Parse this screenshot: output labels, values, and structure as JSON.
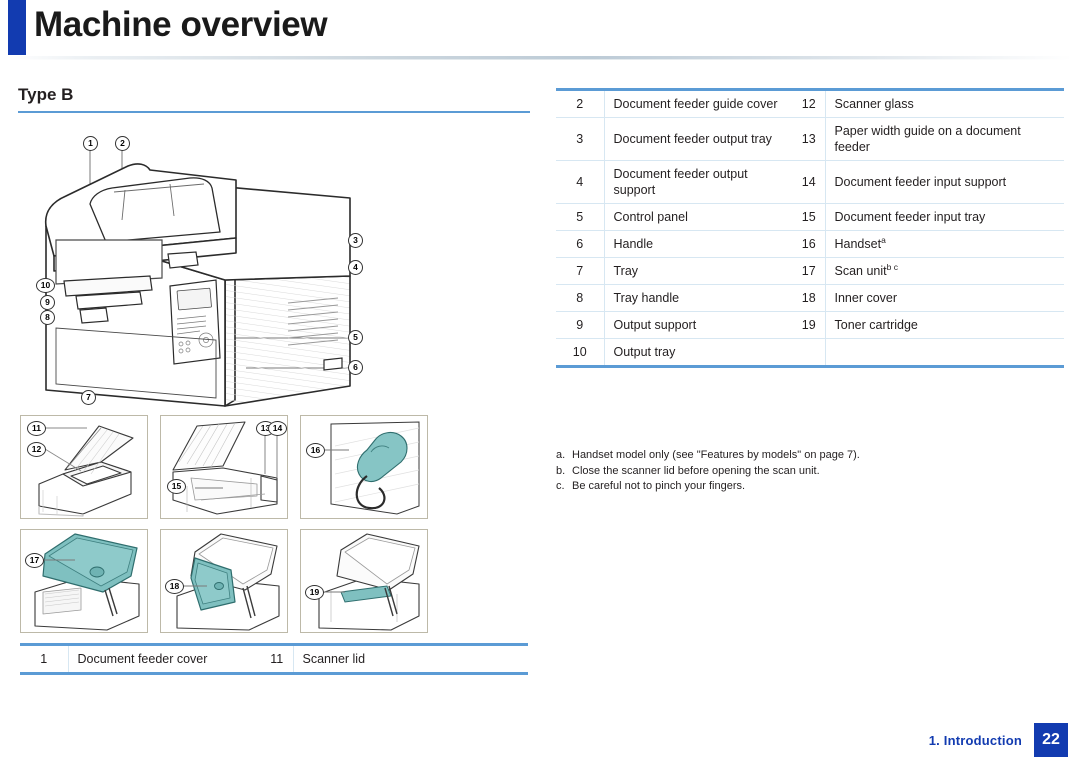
{
  "header": {
    "title": "Machine overview"
  },
  "section": {
    "title": "Type B"
  },
  "right_table": {
    "rows": [
      {
        "num": "2",
        "label": "Document feeder guide cover",
        "num2": "12",
        "label2": "Scanner glass"
      },
      {
        "num": "3",
        "label": "Document feeder output tray",
        "num2": "13",
        "label2": "Paper width guide on a document feeder"
      },
      {
        "num": "4",
        "label": "Document feeder output support",
        "num2": "14",
        "label2": "Document feeder input support"
      },
      {
        "num": "5",
        "label": "Control panel",
        "num2": "15",
        "label2": "Document feeder input tray"
      },
      {
        "num": "6",
        "label": "Handle",
        "num2": "16",
        "label2": "Handset",
        "sup2": "a"
      },
      {
        "num": "7",
        "label": "Tray",
        "num2": "17",
        "label2": "Scan unit",
        "sup2": "b c"
      },
      {
        "num": "8",
        "label": "Tray handle",
        "num2": "18",
        "label2": "Inner cover"
      },
      {
        "num": "9",
        "label": "Output support",
        "num2": "19",
        "label2": "Toner cartridge"
      },
      {
        "num": "10",
        "label": "Output tray",
        "num2": "",
        "label2": ""
      }
    ]
  },
  "bottom_table": {
    "rows": [
      {
        "num": "1",
        "label": "Document feeder cover",
        "num2": "11",
        "label2": "Scanner lid"
      }
    ]
  },
  "footnotes": [
    {
      "marker": "a.",
      "text": "Handset model only (see \"Features by models\" on page 7)."
    },
    {
      "marker": "b.",
      "text": "Close the scanner lid before opening the scan unit."
    },
    {
      "marker": "c.",
      "text": "Be careful not to pinch your fingers."
    }
  ],
  "footer": {
    "chapter": "1. Introduction",
    "page": "22"
  },
  "illustration": {
    "main_callouts": [
      "1",
      "2",
      "3",
      "4",
      "5",
      "6",
      "7",
      "8",
      "9",
      "10"
    ],
    "thumb_callouts": [
      {
        "panel": 1,
        "labels": [
          "11",
          "12"
        ]
      },
      {
        "panel": 2,
        "labels": [
          "13",
          "14",
          "15"
        ]
      },
      {
        "panel": 3,
        "labels": [
          "16"
        ]
      },
      {
        "panel": 4,
        "labels": [
          "17"
        ]
      },
      {
        "panel": 5,
        "labels": [
          "18"
        ]
      },
      {
        "panel": 6,
        "labels": [
          "19"
        ]
      }
    ]
  },
  "colors": {
    "accent_blue": "#123bb0",
    "rule_blue": "#5b9bd5",
    "table_grid": "#d7e7f2",
    "teal_part": "#7fc4c4"
  }
}
